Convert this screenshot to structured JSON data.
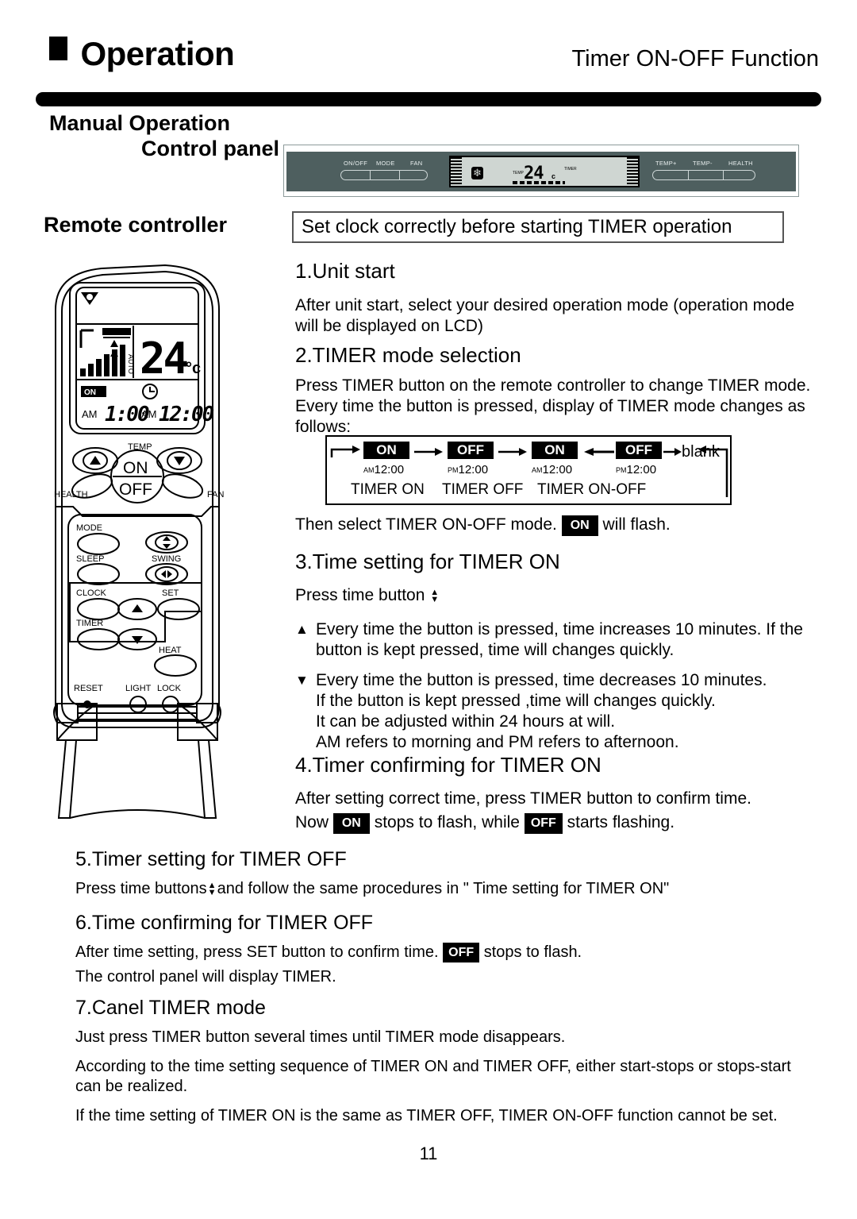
{
  "header": {
    "title": "Operation",
    "right_title": "Timer ON-OFF Function"
  },
  "left_column": {
    "manual_operation": "Manual Operation",
    "control_panel": "Control panel",
    "remote_controller": "Remote controller"
  },
  "control_panel_illustration": {
    "left_buttons": [
      "ON/OFF",
      "MODE",
      "FAN"
    ],
    "right_buttons": [
      "TEMP+",
      "TEMP-",
      "HEALTH"
    ],
    "lcd": {
      "snowflake_icon": "snowflake-icon",
      "temp_label": "TEMP",
      "temperature": "24",
      "unit": "c",
      "timer_label": "TIMER"
    }
  },
  "remote_controller": {
    "lcd": {
      "temperature": "24",
      "unit": "c",
      "fan_auto_label": "AUTO",
      "on_badge": "ON",
      "timer_on_ampm": "AM",
      "timer_on_time": "1:00",
      "clock_ampm": "AM",
      "clock_time": "12:00"
    },
    "buttons": {
      "temp": "TEMP",
      "on": "ON",
      "off": "OFF",
      "health": "HEALTH",
      "fan": "FAN",
      "mode": "MODE",
      "sleep": "SLEEP",
      "swing": "SWING",
      "clock": "CLOCK",
      "set": "SET",
      "timer": "TIMER",
      "heat": "HEAT",
      "reset": "RESET",
      "light": "LIGHT",
      "lock": "LOCK"
    }
  },
  "callout": "Set clock correctly before starting TIMER operation",
  "sections": {
    "s1_heading": "1.Unit start",
    "s1_body": "After unit start, select your desired operation mode (operation mode will be displayed on LCD)",
    "s2_heading": "2.TIMER mode selection",
    "s2_body": "Press TIMER button on the remote controller to change TIMER mode. Every time the button is pressed, display of TIMER mode changes as follows:",
    "s2_after_pre": "Then select TIMER ON-OFF mode.",
    "s2_after_tag": "ON",
    "s2_after_post": "will flash.",
    "s3_heading": "3.Time setting for TIMER ON",
    "s3_press": "Press time button",
    "s3_up": "Every time the button is pressed, time increases 10 minutes. If the button is kept pressed, time will changes quickly.",
    "s3_down_l1": "Every time the button is pressed, time decreases 10 minutes.",
    "s3_down_l2": "If the button is kept pressed ,time will changes quickly.",
    "s3_down_l3": "It can be adjusted within 24 hours at will.",
    "s3_down_l4": "AM refers to morning and PM refers to afternoon.",
    "s4_heading": "4.Timer confirming for TIMER ON",
    "s4_l1": "After setting correct time, press TIMER button to confirm time.",
    "s4_l2_a": "Now",
    "s4_l2_tag1": "ON",
    "s4_l2_b": "stops to flash, while",
    "s4_l2_tag2": "OFF",
    "s4_l2_c": "starts flashing.",
    "s5_heading": "5.Timer setting for TIMER OFF",
    "s5_a": "Press time buttons",
    "s5_b": "and follow the same procedures in \" Time setting for TIMER ON\"",
    "s6_heading": "6.Time confirming for TIMER OFF",
    "s6_a": "After time setting, press SET button to confirm time.",
    "s6_tag": "OFF",
    "s6_b": "stops to flash.",
    "s6_l2": "The control panel will display TIMER.",
    "s7_heading": "7.Canel TIMER mode",
    "s7_l1": "Just press TIMER button several times until TIMER mode disappears.",
    "s7_l2": "According to the time setting sequence of TIMER ON and TIMER OFF, either start-stops or stops-start can be realized.",
    "s7_l3": "If the time setting of TIMER ON is the same as TIMER OFF, TIMER ON-OFF function cannot be set."
  },
  "timer_sequence": {
    "steps": [
      {
        "tag": "ON",
        "ampm": "AM",
        "time": "12:00",
        "name": "TIMER ON"
      },
      {
        "tag": "OFF",
        "ampm": "PM",
        "time": "12:00",
        "name": "TIMER OFF"
      },
      {
        "tag": "ON",
        "ampm": "AM",
        "time": "12:00",
        "name": "TIMER ON-OFF"
      },
      {
        "tag": "OFF",
        "ampm": "PM",
        "time": "12:00",
        "name": ""
      }
    ],
    "blank_label": "blank"
  },
  "page_number": "11",
  "colors": {
    "panel_body": "#4e5f5f",
    "lcd": "#cfd6d2",
    "ink": "#000000"
  }
}
